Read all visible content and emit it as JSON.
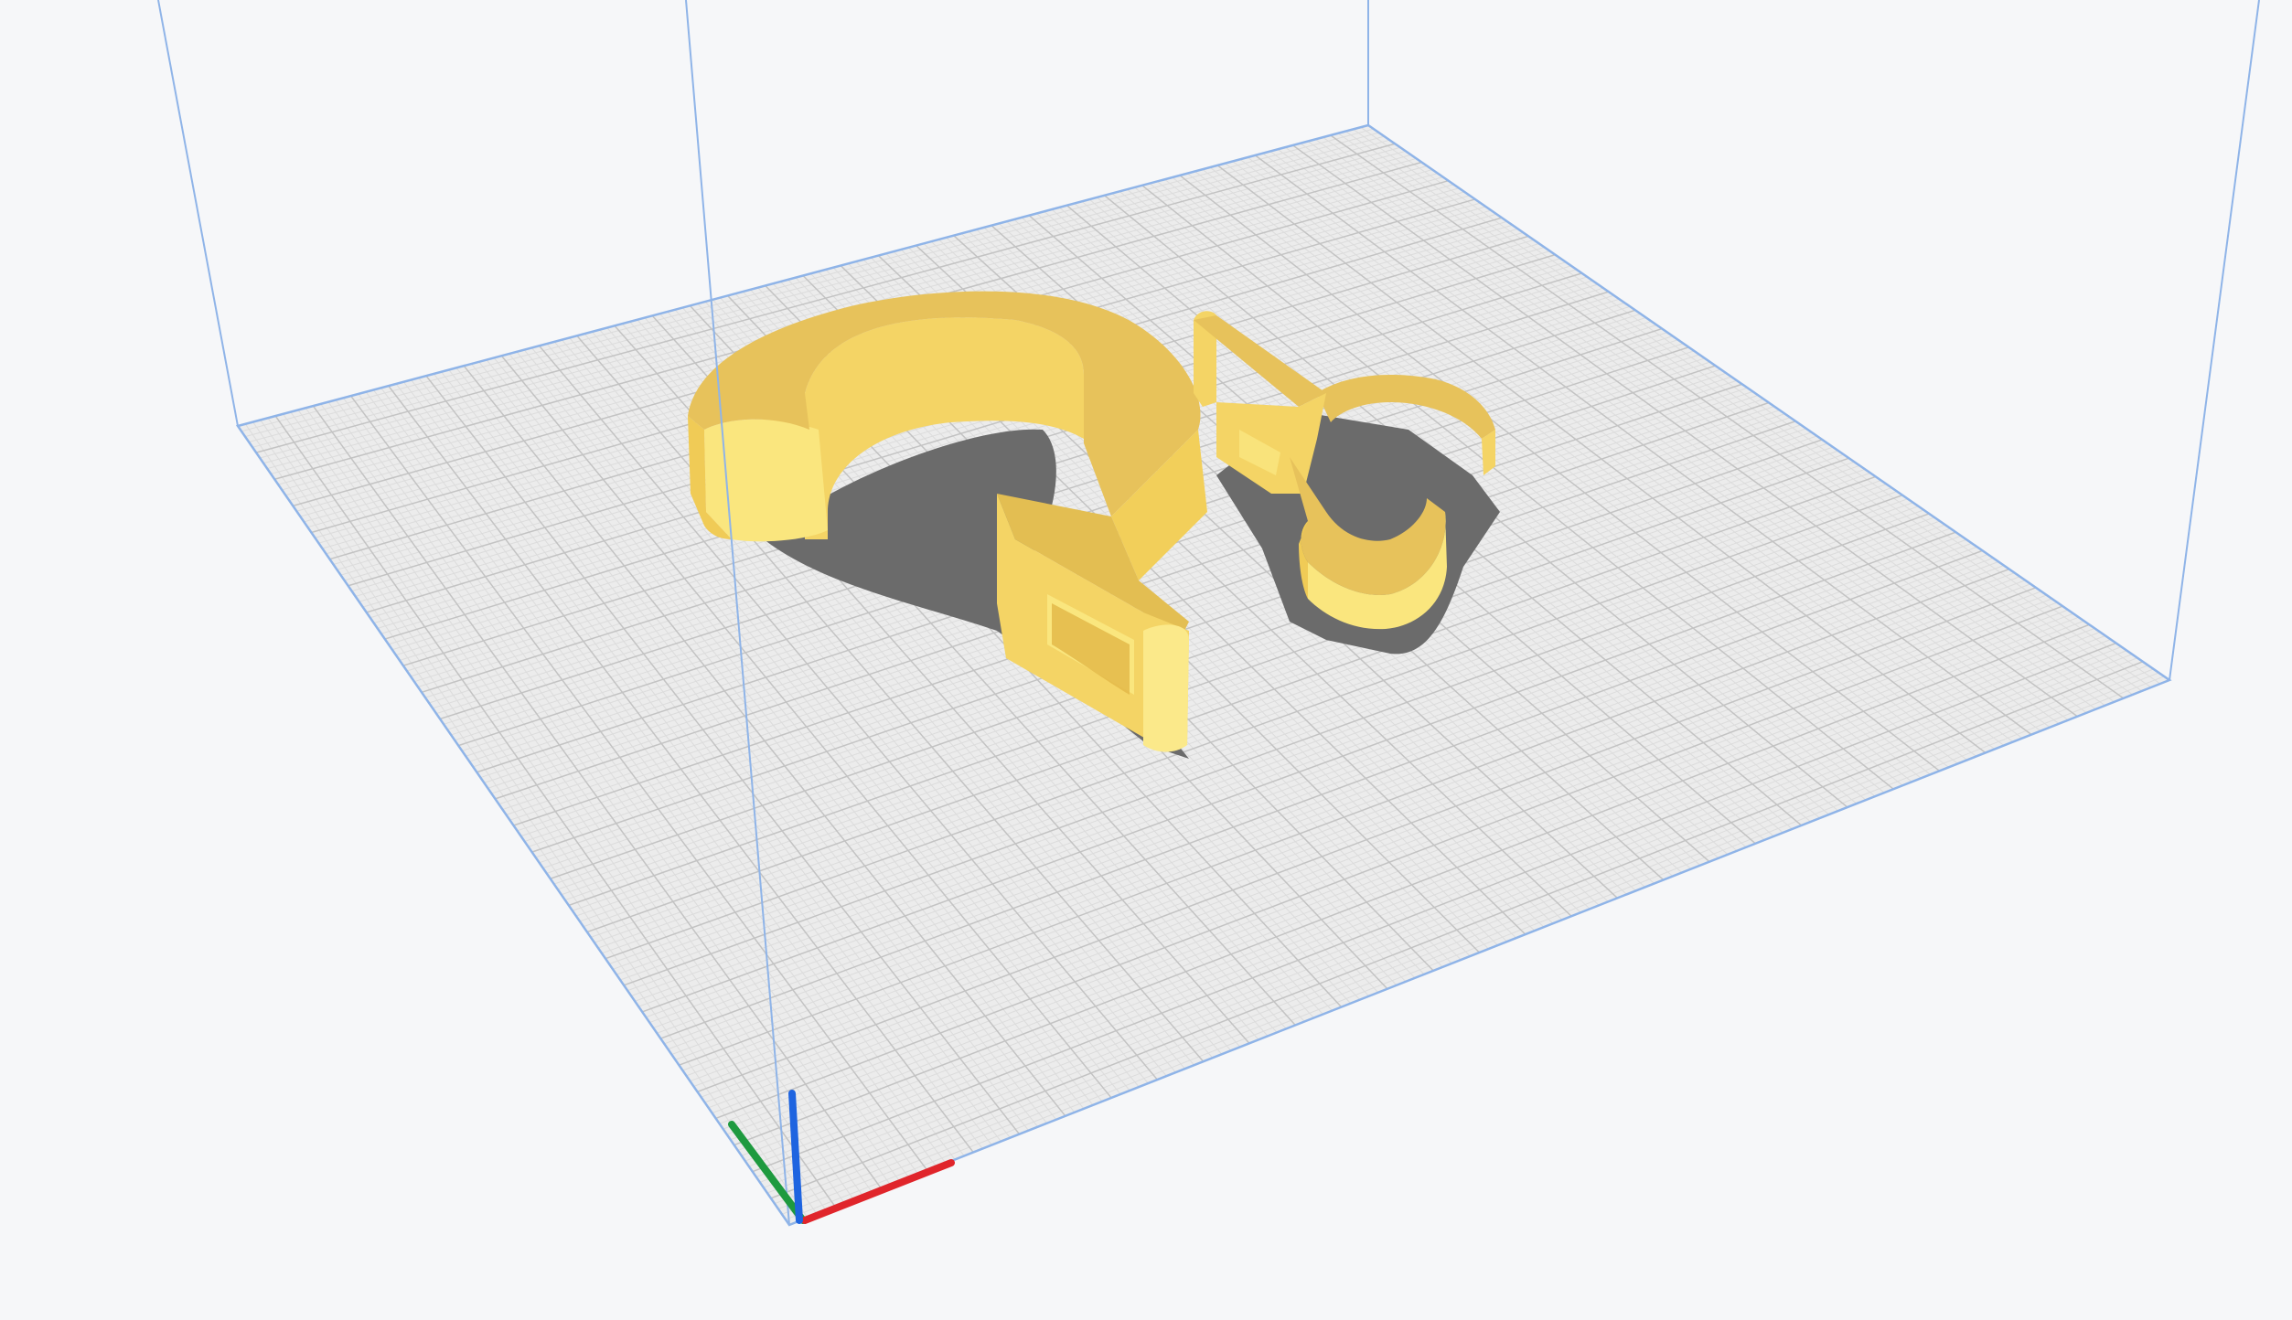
{
  "viewport": {
    "background_color": "#f6f7f9",
    "build_plate": {
      "surface_color": "#ececec",
      "fine_grid_color": "#dcdcdc",
      "major_grid_color": "#c3c3c3",
      "outline_color": "#8fb4e8"
    },
    "build_volume_outline_color": "#8fb4e8",
    "model_color": "#f2cf5a",
    "model_shadow_color": "#6b6b6b",
    "axes": [
      {
        "name": "x-axis",
        "color": "#e0252b"
      },
      {
        "name": "y-axis",
        "color": "#1e9a3f"
      },
      {
        "name": "z-axis",
        "color": "#1e64e0"
      }
    ],
    "objects": [
      {
        "name": "large-hook-model"
      },
      {
        "name": "small-hook-model"
      }
    ]
  }
}
